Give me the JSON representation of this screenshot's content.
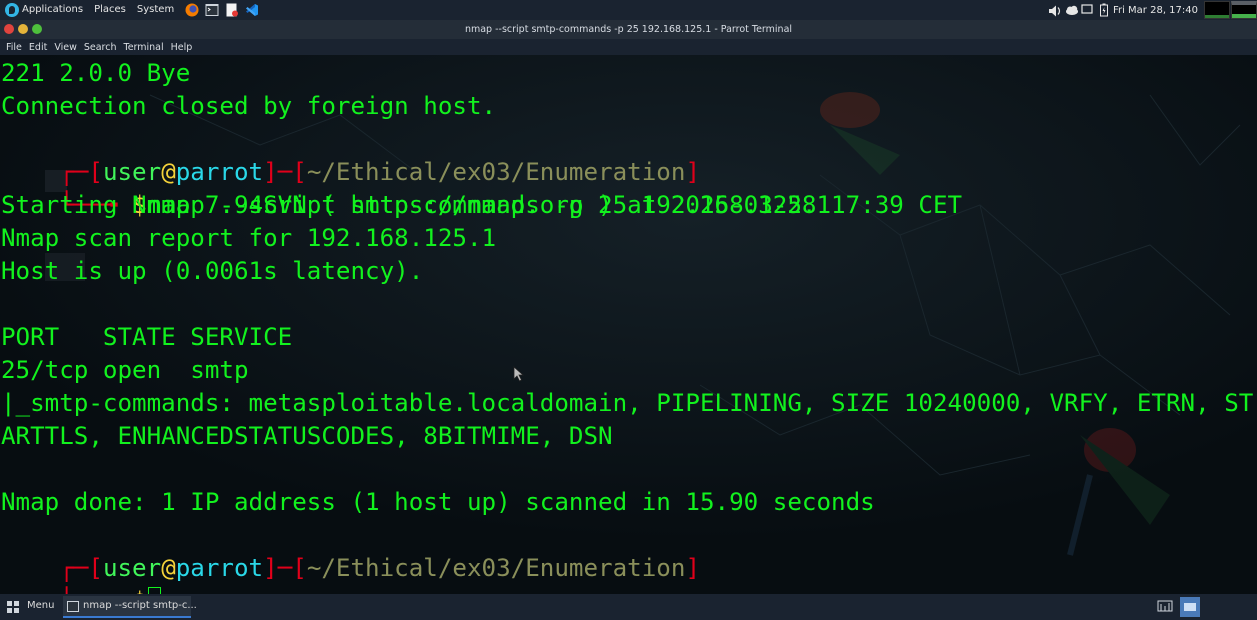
{
  "top_panel": {
    "menus": [
      "Applications",
      "Places",
      "System"
    ],
    "datetime": "Fri Mar 28, 17:40"
  },
  "window": {
    "title": "nmap --script smtp-commands -p 25 192.168.125.1 - Parrot Terminal",
    "menu": [
      "File",
      "Edit",
      "View",
      "Search",
      "Terminal",
      "Help"
    ]
  },
  "terminal": {
    "line1": "221 2.0.0 Bye",
    "line2": "Connection closed by foreign host.",
    "prompt1": {
      "user": "user",
      "at": "@",
      "host": "parrot",
      "path": "~/Ethical/ex03/Enumeration",
      "dollar": "$",
      "command": "nmap --script smtp-commands -p 25 192.168.125.1"
    },
    "output": [
      "Starting Nmap 7.94SVN ( https://nmap.org ) at 2025-03-28 17:39 CET",
      "Nmap scan report for 192.168.125.1",
      "Host is up (0.0061s latency).",
      "",
      "PORT   STATE SERVICE",
      "25/tcp open  smtp",
      "|_smtp-commands: metasploitable.localdomain, PIPELINING, SIZE 10240000, VRFY, ETRN, ST",
      "ARTTLS, ENHANCEDSTATUSCODES, 8BITMIME, DSN",
      "",
      "Nmap done: 1 IP address (1 host up) scanned in 15.90 seconds"
    ],
    "prompt2": {
      "user": "user",
      "at": "@",
      "host": "parrot",
      "path": "~/Ethical/ex03/Enumeration",
      "dollar": "$"
    }
  },
  "bottom_panel": {
    "menu_label": "Menu",
    "task_label": "nmap --script smtp-c..."
  },
  "colors": {
    "terminal_green": "#12f21e",
    "prompt_red": "#e0001a",
    "host_cyan": "#2ad8e8",
    "dollar_yellow": "#f4d23a"
  },
  "icons": [
    "parrot-logo-icon",
    "firefox-icon",
    "terminal-launcher-icon",
    "text-editor-icon",
    "vscode-icon",
    "volume-icon",
    "weather-icon",
    "notification-icon",
    "battery-icon",
    "show-desktop-icon",
    "workspace-icon"
  ]
}
